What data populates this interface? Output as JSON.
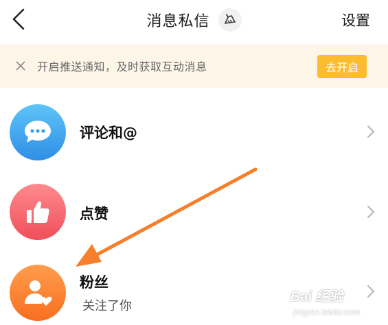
{
  "header": {
    "title": "消息私信",
    "settings_label": "设置",
    "back_icon": "chevron-left-icon",
    "clean_icon": "broom-icon"
  },
  "banner": {
    "text": "开启推送通知，及时获取互动消息",
    "button_label": "去开启",
    "close_icon": "close-icon",
    "button_color": "#fbbd2e",
    "background": "#fdf6e8"
  },
  "items": [
    {
      "label": "评论和@",
      "subtitle": "",
      "icon": "chat-bubble-icon",
      "color_top": "#5fc4f8",
      "color_bottom": "#2f8fe6"
    },
    {
      "label": "点赞",
      "subtitle": "",
      "icon": "thumbs-up-icon",
      "color_top": "#ff8a8e",
      "color_bottom": "#ef4f5a"
    },
    {
      "label": "粉丝",
      "subtitle": "关注了你",
      "icon": "user-heart-icon",
      "color_top": "#ff9d4d",
      "color_bottom": "#f86f1f"
    }
  ],
  "annotation": {
    "arrow_color": "#f57f2a"
  },
  "watermark": {
    "main": "Bai 经验",
    "sub": "jingyan.baidu.com"
  }
}
